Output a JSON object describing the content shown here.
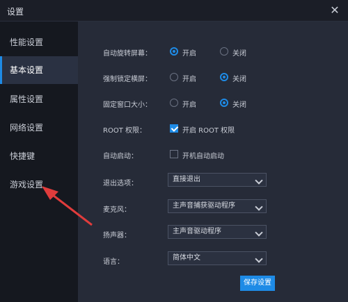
{
  "window": {
    "title": "设置"
  },
  "sidebar": {
    "items": [
      {
        "label": "性能设置"
      },
      {
        "label": "基本设置"
      },
      {
        "label": "属性设置"
      },
      {
        "label": "网络设置"
      },
      {
        "label": "快捷键"
      },
      {
        "label": "游戏设置"
      }
    ]
  },
  "settings": {
    "auto_rotate": {
      "label": "自动旋转屏幕：",
      "on": "开启",
      "off": "关闭"
    },
    "force_landscape": {
      "label": "强制锁定横屏：",
      "on": "开启",
      "off": "关闭"
    },
    "fixed_window": {
      "label": "固定窗口大小：",
      "on": "开启",
      "off": "关闭"
    },
    "root": {
      "label": "ROOT 权限：",
      "checkbox": "开启 ROOT 权限"
    },
    "auto_start": {
      "label": "自动启动：",
      "checkbox": "开机自动启动"
    },
    "exit": {
      "label": "退出选项：",
      "value": "直接退出"
    },
    "mic": {
      "label": "麦克风：",
      "value": "主声音捕获驱动程序"
    },
    "speaker": {
      "label": "扬声器：",
      "value": "主声音驱动程序"
    },
    "language": {
      "label": "语言：",
      "value": "简体中文"
    }
  },
  "footer": {
    "save_label": "保存设置"
  },
  "colors": {
    "accent": "#1e8be6",
    "annotation_arrow": "#e03c3c"
  }
}
